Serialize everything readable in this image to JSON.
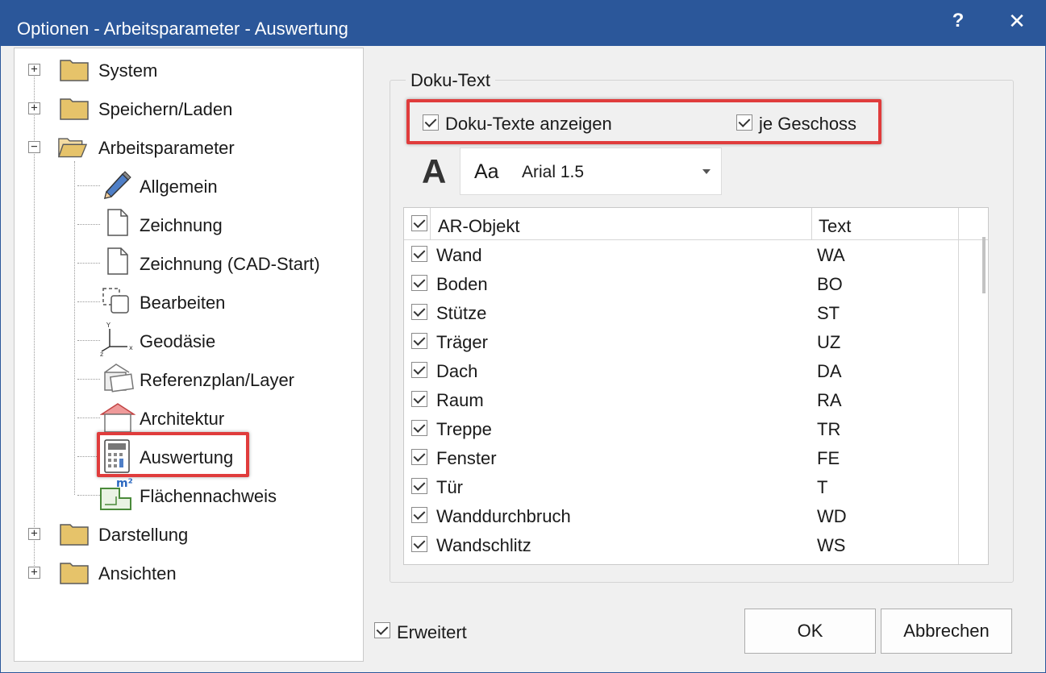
{
  "window": {
    "title": "Optionen - Arbeitsparameter - Auswertung",
    "help": "?",
    "close": "✕"
  },
  "tree": {
    "system": "System",
    "speichern": "Speichern/Laden",
    "arbeitsparameter": "Arbeitsparameter",
    "allgemein": "Allgemein",
    "zeichnung": "Zeichnung",
    "zeichnung_cad": "Zeichnung (CAD-Start)",
    "bearbeiten": "Bearbeiten",
    "geodaesie": "Geodäsie",
    "referenzplan": "Referenzplan/Layer",
    "architektur": "Architektur",
    "auswertung": "Auswertung",
    "flaechennachweis": "Flächennachweis",
    "darstellung": "Darstellung",
    "ansichten": "Ansichten",
    "plus": "+",
    "minus": "−"
  },
  "doku": {
    "group_title": "Doku-Text",
    "show_texts": "Doku-Texte anzeigen",
    "per_floor": "je Geschoss",
    "font_sample": "Aa",
    "font_name": "Arial 1.5",
    "font_icon": "A"
  },
  "table": {
    "col_object": "AR-Objekt",
    "col_text": "Text",
    "rows": [
      {
        "obj": "Wand",
        "text": "WA"
      },
      {
        "obj": "Boden",
        "text": "BO"
      },
      {
        "obj": "Stütze",
        "text": "ST"
      },
      {
        "obj": "Träger",
        "text": "UZ"
      },
      {
        "obj": "Dach",
        "text": "DA"
      },
      {
        "obj": "Raum",
        "text": "RA"
      },
      {
        "obj": "Treppe",
        "text": "TR"
      },
      {
        "obj": "Fenster",
        "text": "FE"
      },
      {
        "obj": "Tür",
        "text": "T"
      },
      {
        "obj": "Wanddurchbruch",
        "text": "WD"
      },
      {
        "obj": "Wandschlitz",
        "text": "WS"
      }
    ]
  },
  "footer": {
    "extended": "Erweitert",
    "ok": "OK",
    "cancel": "Abbrechen"
  }
}
